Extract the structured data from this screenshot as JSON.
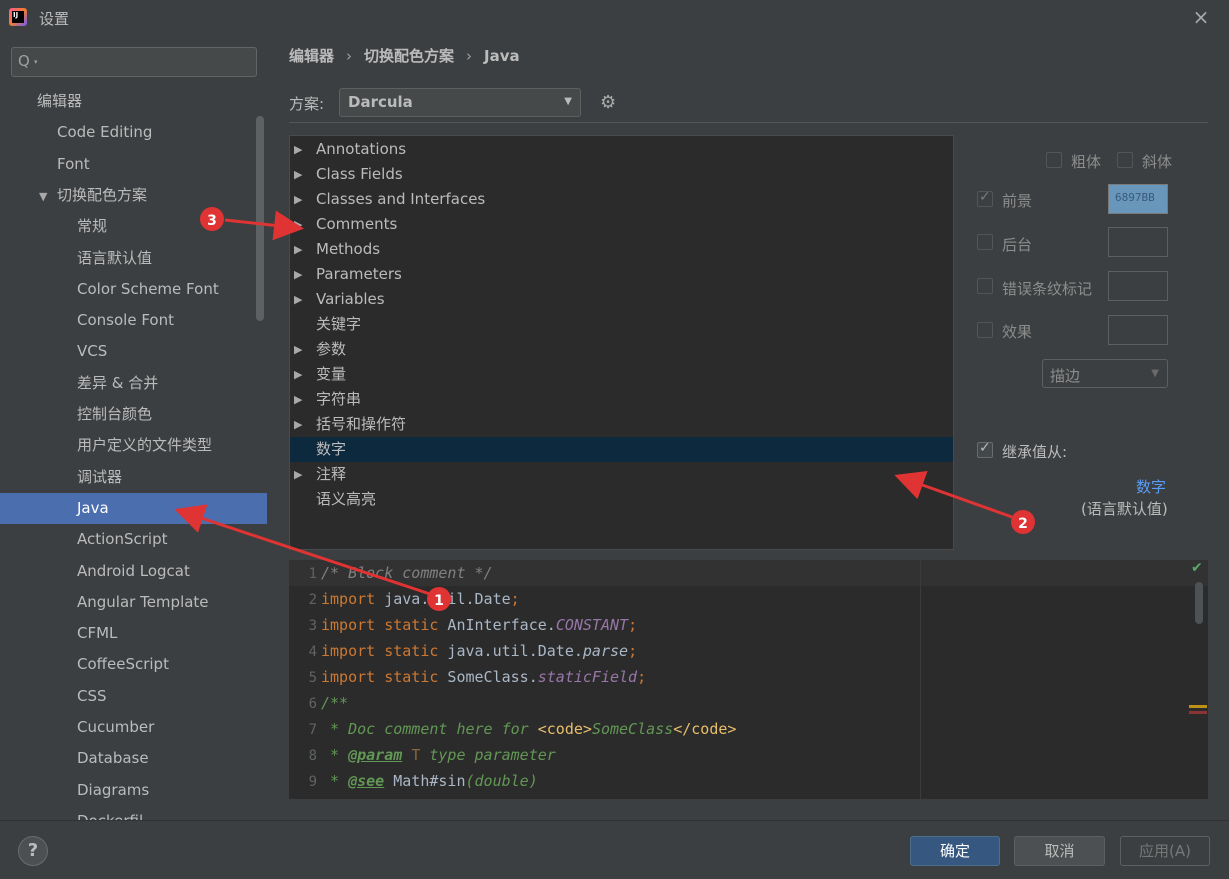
{
  "window": {
    "title": "设置",
    "close_icon": "×"
  },
  "search": {
    "placeholder": "",
    "icon": "Q",
    "caret": "▾"
  },
  "sidebar": {
    "items": [
      {
        "label": "编辑器",
        "level": 0
      },
      {
        "label": "Code Editing",
        "level": 1
      },
      {
        "label": "Font",
        "level": 1
      },
      {
        "label": "切换配色方案",
        "level": 1,
        "expanded": true
      },
      {
        "label": "常规",
        "level": 2
      },
      {
        "label": "语言默认值",
        "level": 2
      },
      {
        "label": "Color Scheme Font",
        "level": 2
      },
      {
        "label": "Console Font",
        "level": 2
      },
      {
        "label": "VCS",
        "level": 2
      },
      {
        "label": "差异 & 合并",
        "level": 2
      },
      {
        "label": "控制台颜色",
        "level": 2
      },
      {
        "label": "用户定义的文件类型",
        "level": 2
      },
      {
        "label": "调试器",
        "level": 2
      },
      {
        "label": "Java",
        "level": 2,
        "selected": true
      },
      {
        "label": "ActionScript",
        "level": 2
      },
      {
        "label": "Android Logcat",
        "level": 2
      },
      {
        "label": "Angular Template",
        "level": 2
      },
      {
        "label": "CFML",
        "level": 2
      },
      {
        "label": "CoffeeScript",
        "level": 2
      },
      {
        "label": "CSS",
        "level": 2
      },
      {
        "label": "Cucumber",
        "level": 2
      },
      {
        "label": "Database",
        "level": 2
      },
      {
        "label": "Diagrams",
        "level": 2
      },
      {
        "label": "Dockerfil",
        "level": 2
      }
    ]
  },
  "breadcrumb": {
    "part1": "编辑器",
    "part2": "切换配色方案",
    "part3": "Java",
    "separator": "›"
  },
  "scheme": {
    "label": "方案:",
    "value": "Darcula"
  },
  "tree": {
    "items": [
      {
        "label": "Annotations",
        "has_children": true
      },
      {
        "label": "Class Fields",
        "has_children": true
      },
      {
        "label": "Classes and Interfaces",
        "has_children": true
      },
      {
        "label": "Comments",
        "has_children": true
      },
      {
        "label": "Methods",
        "has_children": true
      },
      {
        "label": "Parameters",
        "has_children": true
      },
      {
        "label": "Variables",
        "has_children": true
      },
      {
        "label": "关键字",
        "has_children": false
      },
      {
        "label": "参数",
        "has_children": true
      },
      {
        "label": "变量",
        "has_children": true
      },
      {
        "label": "字符串",
        "has_children": true
      },
      {
        "label": "括号和操作符",
        "has_children": true
      },
      {
        "label": "数字",
        "has_children": false,
        "selected": true
      },
      {
        "label": "注释",
        "has_children": true
      },
      {
        "label": "语义高亮",
        "has_children": false
      }
    ]
  },
  "props": {
    "bold": "粗体",
    "italic": "斜体",
    "foreground": "前景",
    "foreground_hex": "6897BB",
    "background": "后台",
    "error_stripe": "错误条纹标记",
    "effects": "效果",
    "effect_type": "描边",
    "inherit": "继承值从:",
    "inherit_link": "数字",
    "inherit_note": "(语言默认值)"
  },
  "code": {
    "line_numbers": [
      "1",
      "2",
      "3",
      "4",
      "5",
      "6",
      "7",
      "8",
      "9"
    ]
  },
  "buttons": {
    "ok": "确定",
    "cancel": "取消",
    "apply": "应用(A)",
    "help": "?"
  },
  "annotations": {
    "a1": "1",
    "a2": "2",
    "a3": "3"
  },
  "colors": {
    "accent": "#4b6eaf",
    "tree_selected": "#0d293e",
    "foreground_swatch": "#6897bb",
    "annotation_red": "#e03333",
    "link": "#589df6"
  }
}
